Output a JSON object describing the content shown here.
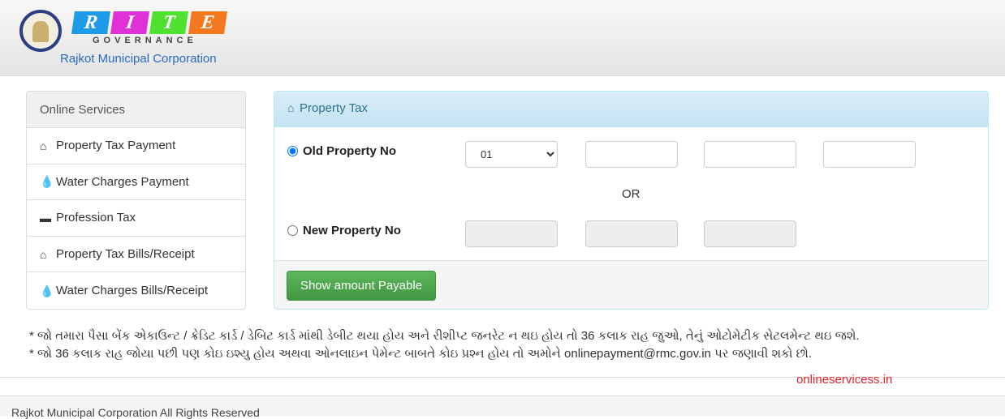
{
  "header": {
    "logo_letters": [
      "R",
      "I",
      "T",
      "E"
    ],
    "logo_colors": [
      "#1e9be8",
      "#e030d8",
      "#50e030",
      "#f47820"
    ],
    "governance": "GOVERNANCE",
    "org": "Rajkot Municipal Corporation"
  },
  "sidebar": {
    "title": "Online Services",
    "items": [
      {
        "label": "Property Tax Payment",
        "icon": "home-icon"
      },
      {
        "label": "Water Charges Payment",
        "icon": "drop-icon"
      },
      {
        "label": "Profession Tax",
        "icon": "briefcase-icon"
      },
      {
        "label": "Property Tax Bills/Receipt",
        "icon": "home-icon"
      },
      {
        "label": "Water Charges Bills/Receipt",
        "icon": "drop-icon"
      }
    ]
  },
  "panel": {
    "title": "Property Tax",
    "old_label": "Old Property No",
    "old_selected": true,
    "zone_value": "01",
    "or": "OR",
    "new_label": "New Property No",
    "new_selected": false,
    "button": "Show amount Payable"
  },
  "notes": [
    "* જો તમારા પૈસા બેંક એકાઉન્ટ / ક્રેડિટ કાર્ડ / ડેબિટ કાર્ડ માંથી ડેબીટ થયા હોય અને રીશીપ્ટ જનરેટ ન થઇ હોય તો 36 કલાક રાહ જુઓ, તેનું ઓટોમેટીક સેટલમેન્ટ થઇ જશે.",
    "* જો 36 કલાક રાહ જોયા પછી પણ કોઇ ઇશ્યુ હોય અથવા ઓનલાઇન પેમેન્ટ બાબતે કોઇ પ્રશ્ન હોય તો અમોને onlinepayment@rmc.gov.in પર જણાવી શકો છો."
  ],
  "watermark": "onlineservicess.in",
  "footer": "Rajkot Municipal Corporation All Rights Reserved"
}
